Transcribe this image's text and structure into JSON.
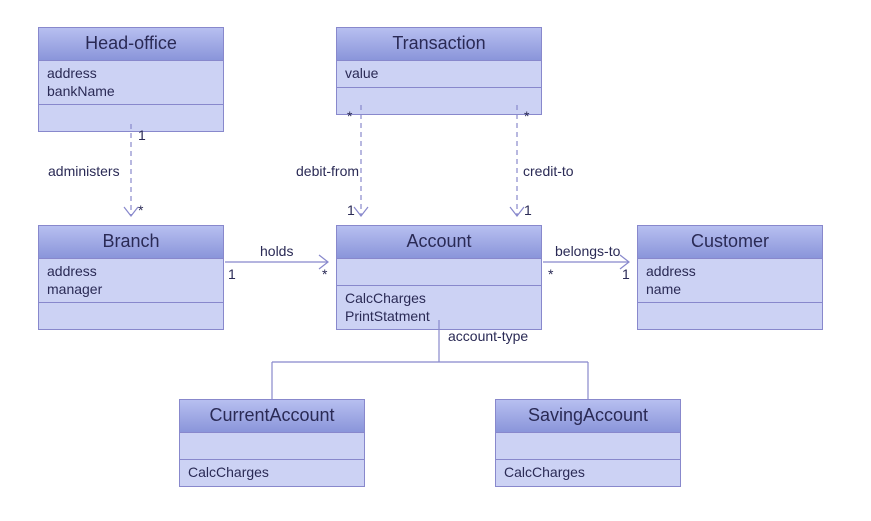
{
  "classes": {
    "headOffice": {
      "title": "Head-office",
      "attrs": [
        "address",
        "bankName"
      ]
    },
    "transaction": {
      "title": "Transaction",
      "attrs": [
        "value"
      ]
    },
    "branch": {
      "title": "Branch",
      "attrs": [
        "address",
        "manager"
      ]
    },
    "account": {
      "title": "Account",
      "ops": [
        "CalcCharges",
        "PrintStatment"
      ]
    },
    "customer": {
      "title": "Customer",
      "attrs": [
        "address",
        "name"
      ]
    },
    "currentAccount": {
      "title": "CurrentAccount",
      "ops": [
        "CalcCharges"
      ]
    },
    "savingAccount": {
      "title": "SavingAccount",
      "ops": [
        "CalcCharges"
      ]
    }
  },
  "relations": {
    "administers": {
      "label": "administers",
      "m1": "1",
      "m2": "*"
    },
    "debitFrom": {
      "label": "debit-from",
      "m1": "*",
      "m2": "1"
    },
    "creditTo": {
      "label": "credit-to",
      "m1": "*",
      "m2": "1"
    },
    "holds": {
      "label": "holds",
      "m1": "1",
      "m2": "*"
    },
    "belongsTo": {
      "label": "belongs-to",
      "m1": "*",
      "m2": "1"
    },
    "accountType": {
      "label": "account-type"
    }
  }
}
